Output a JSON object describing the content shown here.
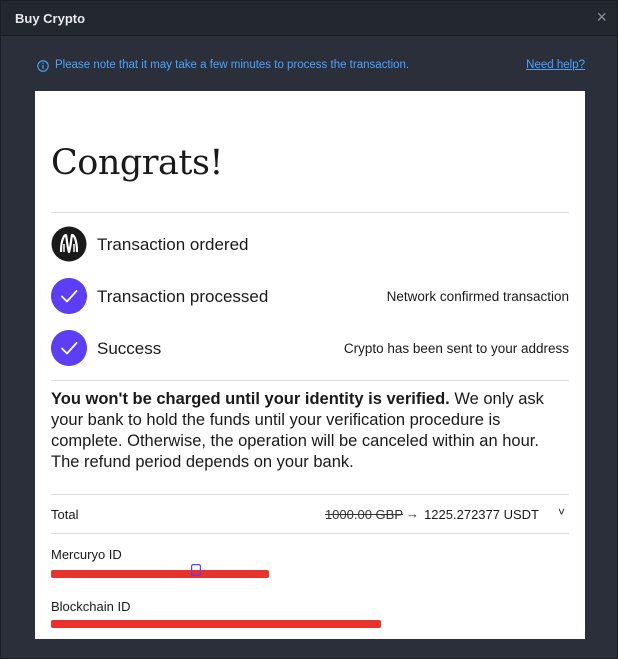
{
  "window": {
    "title": "Buy Crypto",
    "close_glyph": "×"
  },
  "notice": {
    "text": "Please note that it may take a few minutes to process the transaction.",
    "help_link": "Need help?"
  },
  "card": {
    "heading": "Congrats!",
    "steps": [
      {
        "label": "Transaction ordered",
        "note": "",
        "icon": "mercuryo-logo-icon"
      },
      {
        "label": "Transaction processed",
        "note": "Network confirmed transaction",
        "icon": "check-icon"
      },
      {
        "label": "Success",
        "note": "Crypto has been sent to your address",
        "icon": "check-icon"
      }
    ],
    "verification": {
      "bold": "You won't be charged until your identity is verified.",
      "rest": " We only ask your bank to hold the funds until your verification procedure is complete. Otherwise, the operation will be canceled within an hour. The refund period depends on your bank."
    },
    "total": {
      "label": "Total",
      "original": "1000.00 GBP",
      "arrow": "→",
      "converted": "1225.272377 USDT",
      "chevron": "˅"
    },
    "mercuryo_id": {
      "label": "Mercuryo ID"
    },
    "blockchain_id": {
      "label": "Blockchain ID"
    }
  },
  "colors": {
    "accent": "#5b3ef5",
    "link": "#4da3ff",
    "redaction": "#e8322b"
  }
}
